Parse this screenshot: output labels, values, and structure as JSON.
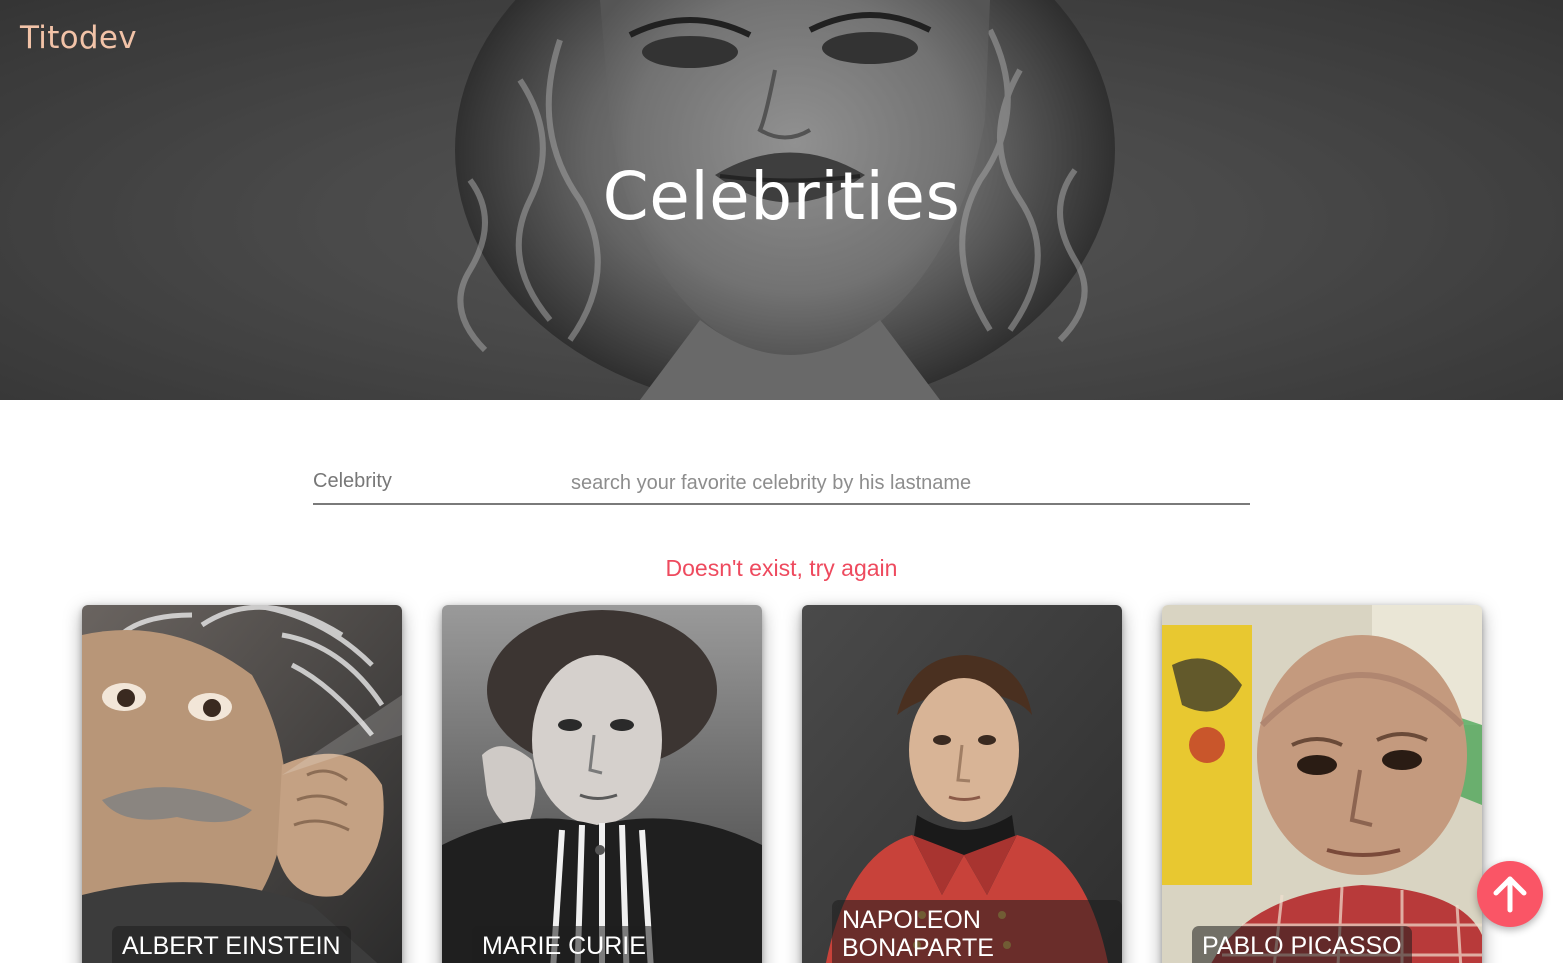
{
  "brand": "Titodev",
  "hero": {
    "title": "Celebrities"
  },
  "search": {
    "label": "Celebrity",
    "placeholder": "search your favorite celebrity by his lastname",
    "value": ""
  },
  "error_message": "Doesn't exist, try again",
  "cards": [
    {
      "name": "ALBERT EINSTEIN"
    },
    {
      "name": "MARIE CURIE"
    },
    {
      "name_line1": "NAPOLEON",
      "name_line2": "BONAPARTE"
    },
    {
      "name": "PABLO PICASSO"
    }
  ],
  "icons": {
    "scroll_top": "arrow-up-icon"
  },
  "colors": {
    "brand": "#f2c3a8",
    "error": "#ee4a5e",
    "fab": "#fa5566"
  }
}
